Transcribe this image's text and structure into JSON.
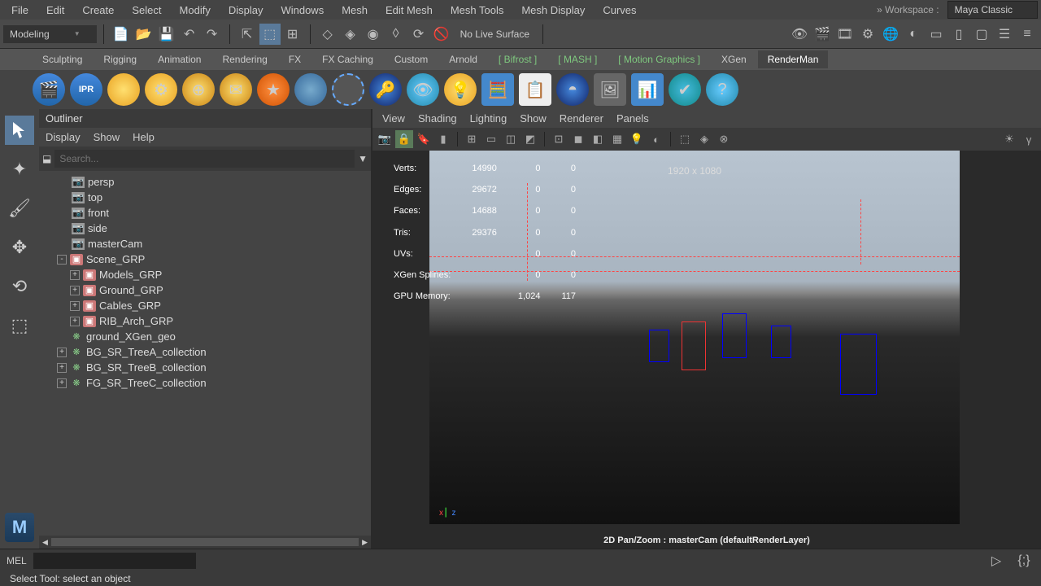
{
  "menu": [
    "File",
    "Edit",
    "Create",
    "Select",
    "Modify",
    "Display",
    "Windows",
    "Mesh",
    "Edit Mesh",
    "Mesh Tools",
    "Mesh Display",
    "Curves"
  ],
  "workspace": {
    "label": "»  Workspace :",
    "value": "Maya Classic"
  },
  "mode": "Modeling",
  "live_surface": "No Live Surface",
  "shelf_tabs": [
    "Sculpting",
    "Rigging",
    "Animation",
    "Rendering",
    "FX",
    "FX Caching",
    "Custom",
    "Arnold",
    "Bifrost",
    "MASH",
    "Motion Graphics",
    "XGen",
    "RenderMan"
  ],
  "outliner": {
    "title": "Outliner",
    "menu": [
      "Display",
      "Show",
      "Help"
    ],
    "search_placeholder": "Search...",
    "items": [
      {
        "pad": 40,
        "ico": "cam",
        "label": "persp"
      },
      {
        "pad": 40,
        "ico": "cam",
        "label": "top"
      },
      {
        "pad": 40,
        "ico": "cam",
        "label": "front"
      },
      {
        "pad": 40,
        "ico": "cam",
        "label": "side"
      },
      {
        "pad": 40,
        "ico": "cam",
        "label": "masterCam"
      },
      {
        "pad": 22,
        "exp": "-",
        "ico": "grp",
        "label": "Scene_GRP"
      },
      {
        "pad": 38,
        "exp": "+",
        "ico": "grp",
        "label": "Models_GRP"
      },
      {
        "pad": 38,
        "exp": "+",
        "ico": "grp",
        "label": "Ground_GRP"
      },
      {
        "pad": 38,
        "exp": "+",
        "ico": "grp",
        "label": "Cables_GRP"
      },
      {
        "pad": 38,
        "exp": "+",
        "ico": "grp",
        "label": "RIB_Arch_GRP"
      },
      {
        "pad": 38,
        "ico": "xg",
        "label": "ground_XGen_geo"
      },
      {
        "pad": 22,
        "exp": "+",
        "ico": "xg",
        "label": "BG_SR_TreeA_collection"
      },
      {
        "pad": 22,
        "exp": "+",
        "ico": "xg",
        "label": "BG_SR_TreeB_collection"
      },
      {
        "pad": 22,
        "exp": "+",
        "ico": "xg",
        "label": "FG_SR_TreeC_collection"
      }
    ]
  },
  "viewport": {
    "menu": [
      "View",
      "Shading",
      "Lighting",
      "Show",
      "Renderer",
      "Panels"
    ],
    "resolution": "1920 x 1080",
    "panzoom": "2D Pan/Zoom : masterCam (defaultRenderLayer)",
    "stats": [
      {
        "k": "Verts:",
        "a": "14990",
        "b": "0",
        "c": "0"
      },
      {
        "k": "Edges:",
        "a": "29672",
        "b": "0",
        "c": "0"
      },
      {
        "k": "Faces:",
        "a": "14688",
        "b": "0",
        "c": "0"
      },
      {
        "k": "Tris:",
        "a": "29376",
        "b": "0",
        "c": "0"
      },
      {
        "k": "UVs:",
        "a": "",
        "b": "0",
        "c": "0"
      },
      {
        "k": "XGen Splines:",
        "a": "",
        "b": "0",
        "c": "0"
      },
      {
        "k": "GPU Memory:",
        "a": "",
        "b": "1,024",
        "c": "117"
      }
    ]
  },
  "mel": "MEL",
  "status": "Select Tool: select an object"
}
